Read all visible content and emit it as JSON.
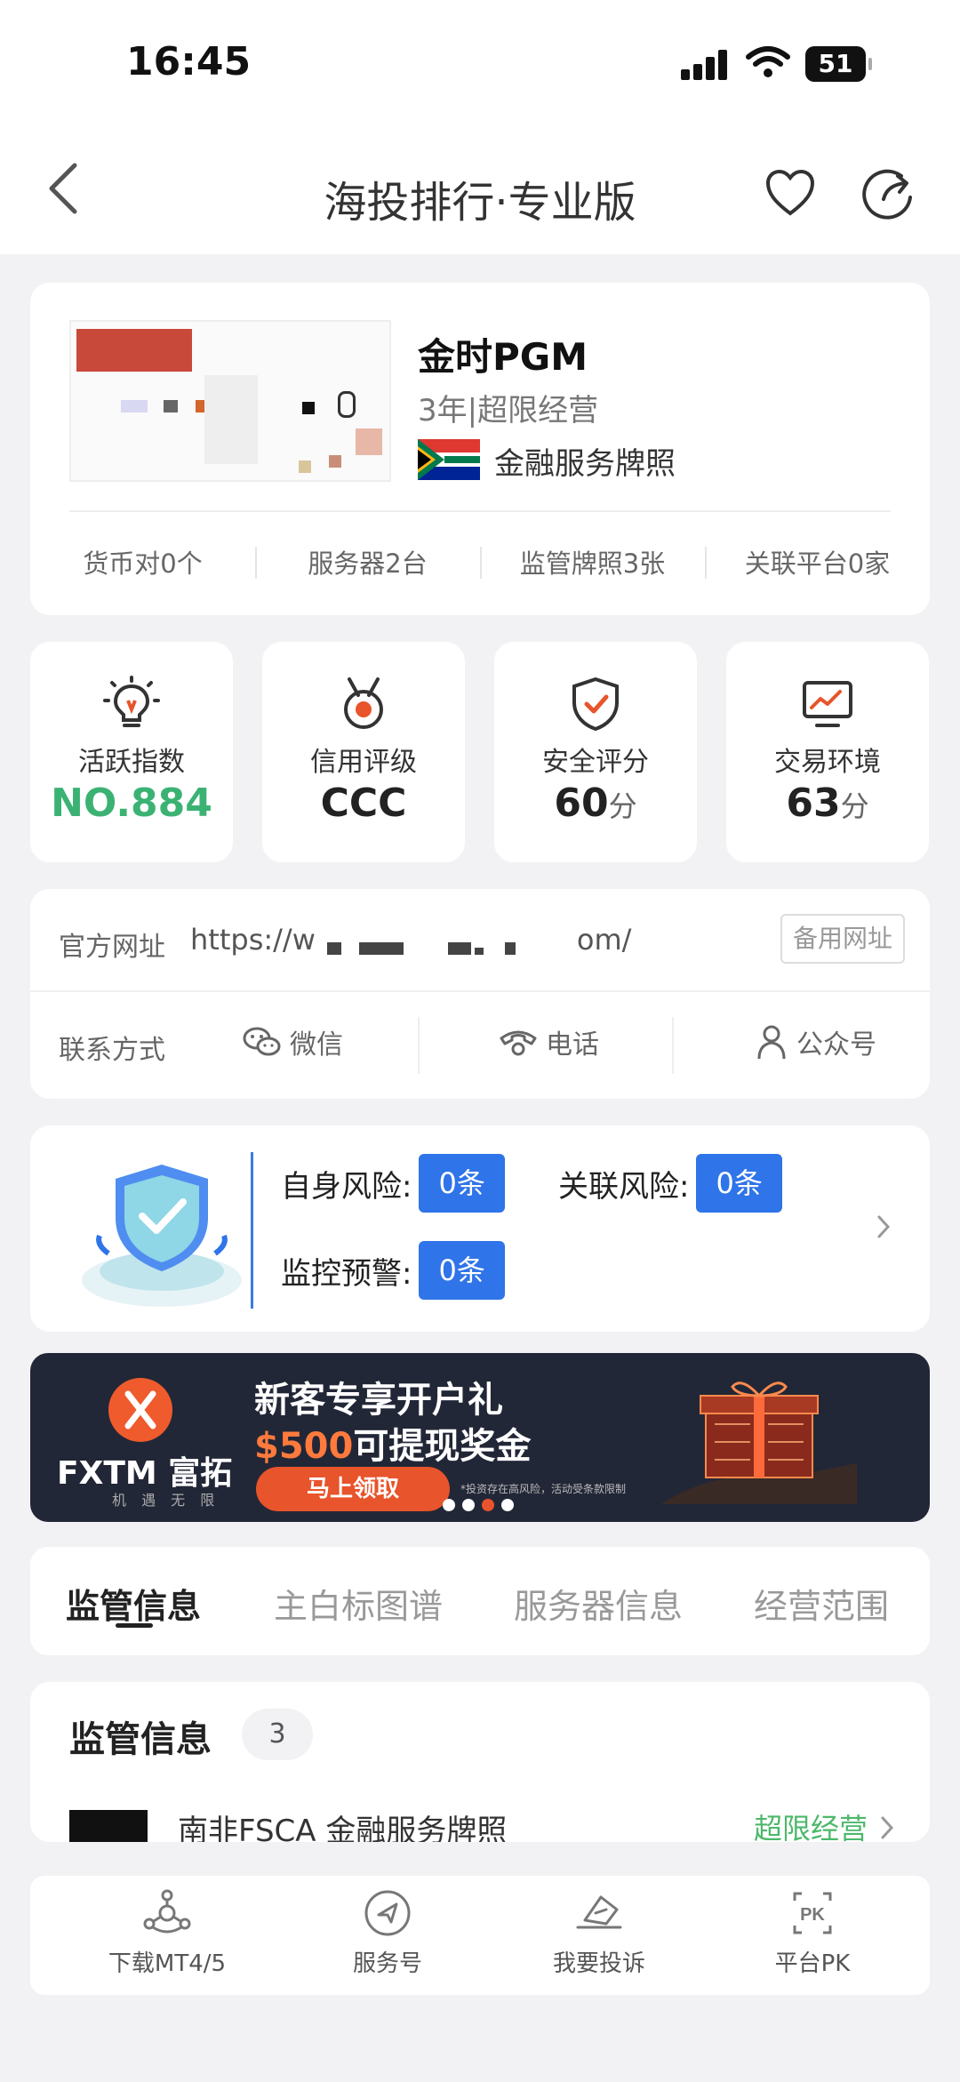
{
  "status_bar": {
    "time": "16:45",
    "battery": "51"
  },
  "nav": {
    "title": "海投排行·专业版"
  },
  "broker": {
    "name": "金时PGM",
    "subtitle": "3年|超限经营",
    "license": "金融服务牌照",
    "stats": [
      "货币对0个",
      "服务器2台",
      "监管牌照3张",
      "关联平台0家"
    ]
  },
  "scores": [
    {
      "label": "活跃指数",
      "value": "NO.884",
      "unit": ""
    },
    {
      "label": "信用评级",
      "value": "CCC",
      "unit": ""
    },
    {
      "label": "安全评分",
      "value": "60",
      "unit": "分"
    },
    {
      "label": "交易环境",
      "value": "63",
      "unit": "分"
    }
  ],
  "contact": {
    "website_label": "官方网址",
    "url_start": "https://w",
    "url_end": "om/",
    "backup_label": "备用网址",
    "contact_label": "联系方式",
    "wechat": "微信",
    "phone": "电话",
    "official_account": "公众号"
  },
  "risk": {
    "self_label": "自身风险:",
    "self_value": "0条",
    "related_label": "关联风险:",
    "related_value": "0条",
    "monitor_label": "监控预警:",
    "monitor_value": "0条"
  },
  "banner": {
    "brand": "FXTM 富拓",
    "tagline": "机 遇 无 限",
    "title": "新客专享开户礼",
    "amount": "$500",
    "subtitle_rest": "可提现奖金",
    "button": "马上领取",
    "note": "*投资存在高风险，活动受条款限制"
  },
  "tabs": [
    "监管信息",
    "主白标图谱",
    "服务器信息",
    "经营范围"
  ],
  "regulation": {
    "title": "监管信息",
    "count": "3",
    "item_name": "南非FSCA 金融服务牌照",
    "item_status": "超限经营"
  },
  "bottom_bar": [
    "下载MT4/5",
    "服务号",
    "我要投诉",
    "平台PK"
  ],
  "colors": {
    "green": "#3bb273",
    "blue": "#2f74e8",
    "orange": "#e8542b"
  }
}
